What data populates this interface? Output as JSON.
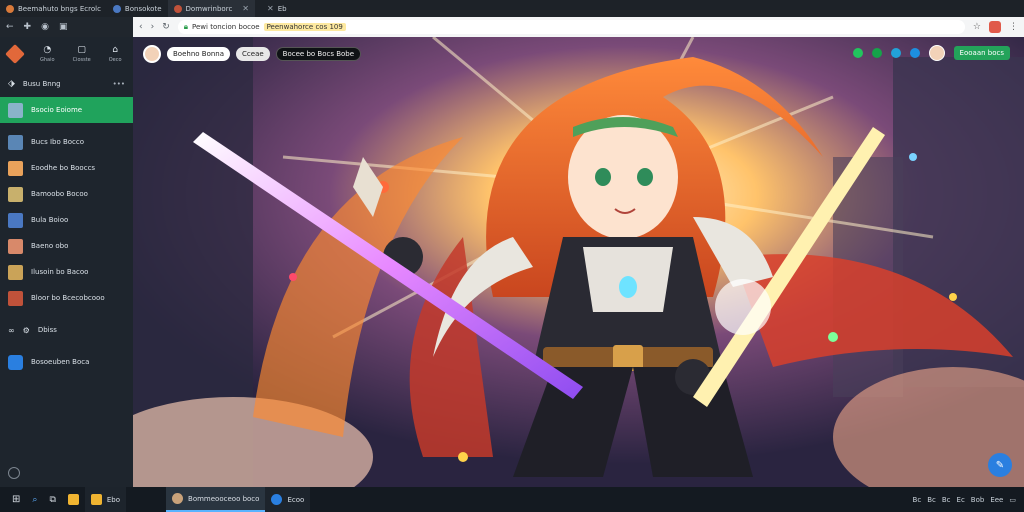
{
  "browser_tabs": [
    {
      "label": "Beemahuto bngs Ecrolc",
      "active": false
    },
    {
      "label": "Bonsokote",
      "active": false
    },
    {
      "label": "Domwrinborc",
      "active": true
    },
    {
      "label": "Eb",
      "active": false
    }
  ],
  "url": {
    "host": "Pewi toncion bocoe",
    "path": "Peenwahorce cos 109"
  },
  "sidebar": {
    "head_icons": [
      "Ghaio",
      "Ciosste",
      "Oeco"
    ],
    "top_item": "Busu   Bnng",
    "items": [
      {
        "label": "Bsocio Eoiome",
        "color": "#8ab3c9",
        "selected": true
      },
      {
        "label": "Bucs Ibo Bocco",
        "color": "#5a86b5",
        "selected": false
      },
      {
        "label": "Eoodhe bo Booccs",
        "color": "#e9a25b",
        "selected": false
      },
      {
        "label": "Bamoobo Bocoo",
        "color": "#c8b06c",
        "selected": false
      },
      {
        "label": "Bula Boioo",
        "color": "#4a78c2",
        "selected": false
      },
      {
        "label": "Baeno obo",
        "color": "#d8896a",
        "selected": false
      },
      {
        "label": "Ilusoin bo Bacoo",
        "color": "#caa358",
        "selected": false
      },
      {
        "label": "Bloor bo Bcecobcooo",
        "color": "#c0523a",
        "selected": false
      }
    ],
    "section": "Dbiss",
    "extra": "Bosoeuben Boca"
  },
  "overlay": {
    "name": "Boehno Bonna",
    "tag": "Cceae",
    "status": "Bocee bo Bocs Bobe",
    "cta": "Eooaan bocs"
  },
  "colors": {
    "accent_green": "#20a35c",
    "accent_blue": "#2a7fe0"
  },
  "taskbar": {
    "apps": [
      "Ebo",
      "Bommeooceoo boco",
      "Ecoo"
    ],
    "tray": [
      "Bc",
      "Bc",
      "Bc",
      "Ec",
      "Bob",
      "Eee"
    ]
  }
}
